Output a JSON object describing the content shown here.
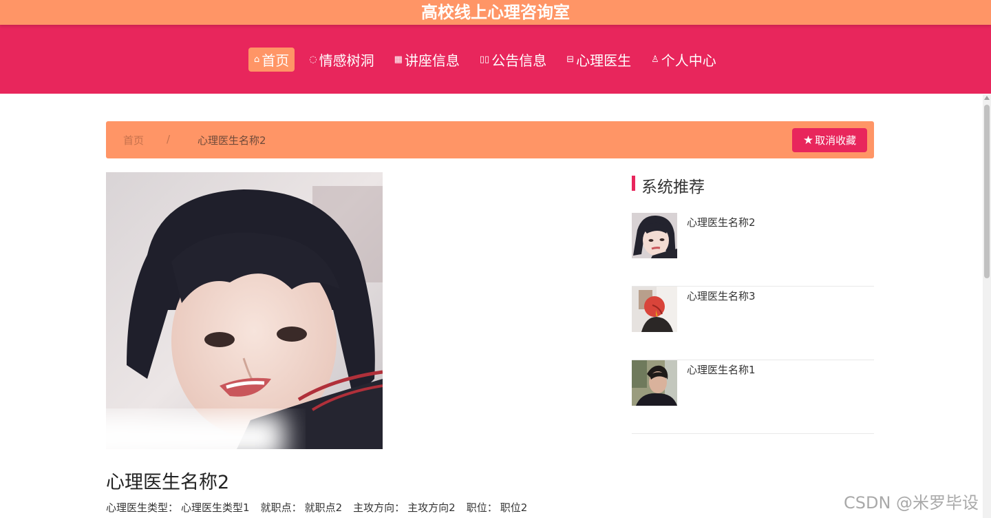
{
  "header": {
    "site_title": "高校线上心理咨询室"
  },
  "nav": {
    "items": [
      {
        "label": "首页",
        "icon": "home-icon",
        "glyph": "⌂",
        "active": true
      },
      {
        "label": "情感树洞",
        "icon": "smile-icon",
        "glyph": "◌",
        "active": false
      },
      {
        "label": "讲座信息",
        "icon": "grid-icon",
        "glyph": "▦",
        "active": false
      },
      {
        "label": "公告信息",
        "icon": "notice-icon",
        "glyph": "▯▯",
        "active": false
      },
      {
        "label": "心理医生",
        "icon": "book-icon",
        "glyph": "⊟",
        "active": false
      },
      {
        "label": "个人中心",
        "icon": "user-icon",
        "glyph": "♙",
        "active": false
      }
    ]
  },
  "breadcrumb": {
    "home": "首页",
    "separator": "/",
    "current": "心理医生名称2"
  },
  "actions": {
    "unfavorite_label": "取消收藏",
    "star_glyph": "★"
  },
  "doctor": {
    "name": "心理医生名称2",
    "type_label": "心理医生类型：",
    "type_value": "心理医生类型1",
    "location_label": "就职点：",
    "location_value": "就职点2",
    "direction_label": "主攻方向：",
    "direction_value": "主攻方向2",
    "position_label": "职位：",
    "position_value": "职位2"
  },
  "sidebar": {
    "title": "系统推荐",
    "items": [
      {
        "name": "心理医生名称2"
      },
      {
        "name": "心理医生名称3"
      },
      {
        "name": "心理医生名称1"
      }
    ]
  },
  "watermark": "CSDN @米罗毕设",
  "colors": {
    "orange": "#ff9566",
    "pink": "#e8265c"
  }
}
